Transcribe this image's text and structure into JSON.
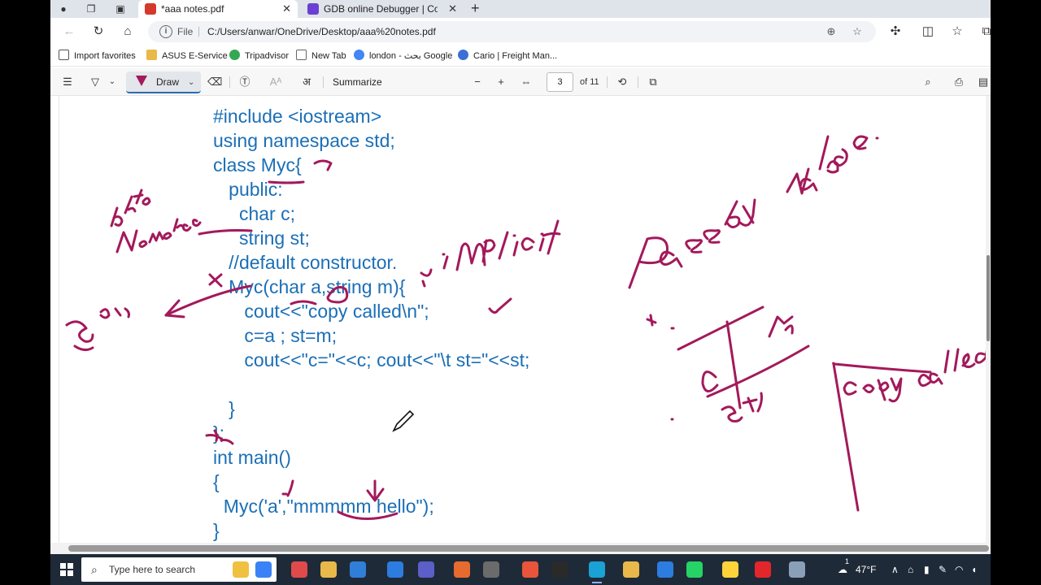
{
  "tabs": [
    {
      "title": "*aaa notes.pdf",
      "active": true,
      "favicon_color": "#d33a2c"
    },
    {
      "title": "GDB online Debugger | Compiler",
      "active": false,
      "favicon_color": "#6b3fd4"
    }
  ],
  "address": {
    "scheme": "File",
    "url": "C:/Users/anwar/OneDrive/Desktop/aaa%20notes.pdf"
  },
  "favorites": [
    {
      "label": "Import favorites",
      "icon": "import-icon",
      "color": "#555555"
    },
    {
      "label": "ASUS E-Service",
      "icon": "folder-icon",
      "color": "#e8b84a"
    },
    {
      "label": "Tripadvisor",
      "icon": "tripadvisor-icon",
      "color": "#34a853"
    },
    {
      "label": "New Tab",
      "icon": "page-icon",
      "color": "#666666"
    },
    {
      "label": "london - بحث Google",
      "icon": "google-icon",
      "color": "#4285f4"
    },
    {
      "label": "Cario | Freight Man...",
      "icon": "cario-icon",
      "color": "#3c6fd6"
    }
  ],
  "pdf_toolbar": {
    "draw_label": "Draw",
    "summarize_label": "Summarize",
    "page_current": "3",
    "page_total_label": "of 11"
  },
  "code_lines": [
    "#include <iostream>",
    "using namespace std;",
    "class Myc{",
    "   public:",
    "     char c;",
    "     string st;",
    "   //default constructor.",
    "   Myc(char a,string m){",
    "      cout<<\"copy called\\n\";",
    "      c=a ; st=m;",
    "      cout<<\"c=\"<<c; cout<<\"\\t st=\"<<st;",
    "",
    "   }",
    "};",
    "int main()",
    "{",
    "  Myc('a',\"mmmmm hello\");",
    "}"
  ],
  "taskbar": {
    "search_placeholder": "Type here to search",
    "weather": "47°F",
    "notification_badge": "1"
  },
  "colors": {
    "code_blue": "#1b6fb6",
    "ink_magenta": "#a3195b",
    "taskbar_bg": "#1f2a38"
  }
}
